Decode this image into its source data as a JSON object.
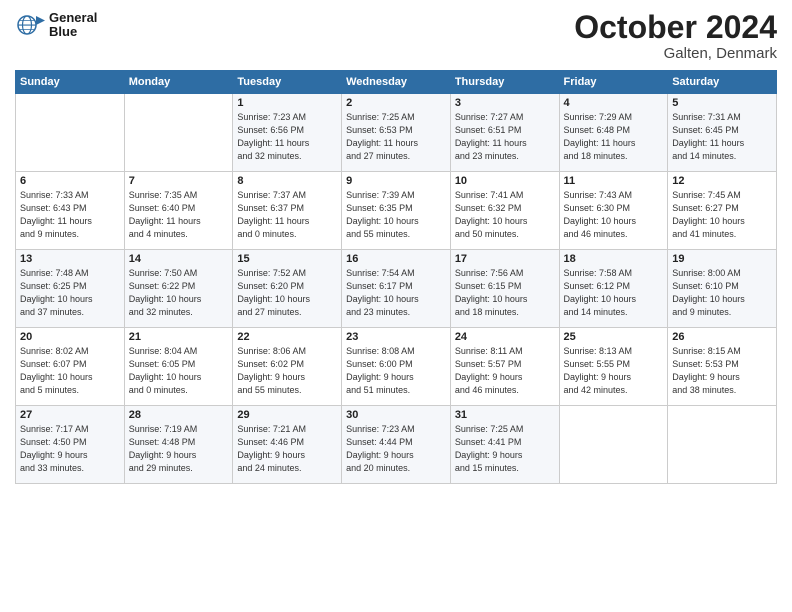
{
  "header": {
    "logo_line1": "General",
    "logo_line2": "Blue",
    "month": "October 2024",
    "location": "Galten, Denmark"
  },
  "days_of_week": [
    "Sunday",
    "Monday",
    "Tuesday",
    "Wednesday",
    "Thursday",
    "Friday",
    "Saturday"
  ],
  "weeks": [
    [
      {
        "day": "",
        "info": ""
      },
      {
        "day": "",
        "info": ""
      },
      {
        "day": "1",
        "info": "Sunrise: 7:23 AM\nSunset: 6:56 PM\nDaylight: 11 hours\nand 32 minutes."
      },
      {
        "day": "2",
        "info": "Sunrise: 7:25 AM\nSunset: 6:53 PM\nDaylight: 11 hours\nand 27 minutes."
      },
      {
        "day": "3",
        "info": "Sunrise: 7:27 AM\nSunset: 6:51 PM\nDaylight: 11 hours\nand 23 minutes."
      },
      {
        "day": "4",
        "info": "Sunrise: 7:29 AM\nSunset: 6:48 PM\nDaylight: 11 hours\nand 18 minutes."
      },
      {
        "day": "5",
        "info": "Sunrise: 7:31 AM\nSunset: 6:45 PM\nDaylight: 11 hours\nand 14 minutes."
      }
    ],
    [
      {
        "day": "6",
        "info": "Sunrise: 7:33 AM\nSunset: 6:43 PM\nDaylight: 11 hours\nand 9 minutes."
      },
      {
        "day": "7",
        "info": "Sunrise: 7:35 AM\nSunset: 6:40 PM\nDaylight: 11 hours\nand 4 minutes."
      },
      {
        "day": "8",
        "info": "Sunrise: 7:37 AM\nSunset: 6:37 PM\nDaylight: 11 hours\nand 0 minutes."
      },
      {
        "day": "9",
        "info": "Sunrise: 7:39 AM\nSunset: 6:35 PM\nDaylight: 10 hours\nand 55 minutes."
      },
      {
        "day": "10",
        "info": "Sunrise: 7:41 AM\nSunset: 6:32 PM\nDaylight: 10 hours\nand 50 minutes."
      },
      {
        "day": "11",
        "info": "Sunrise: 7:43 AM\nSunset: 6:30 PM\nDaylight: 10 hours\nand 46 minutes."
      },
      {
        "day": "12",
        "info": "Sunrise: 7:45 AM\nSunset: 6:27 PM\nDaylight: 10 hours\nand 41 minutes."
      }
    ],
    [
      {
        "day": "13",
        "info": "Sunrise: 7:48 AM\nSunset: 6:25 PM\nDaylight: 10 hours\nand 37 minutes."
      },
      {
        "day": "14",
        "info": "Sunrise: 7:50 AM\nSunset: 6:22 PM\nDaylight: 10 hours\nand 32 minutes."
      },
      {
        "day": "15",
        "info": "Sunrise: 7:52 AM\nSunset: 6:20 PM\nDaylight: 10 hours\nand 27 minutes."
      },
      {
        "day": "16",
        "info": "Sunrise: 7:54 AM\nSunset: 6:17 PM\nDaylight: 10 hours\nand 23 minutes."
      },
      {
        "day": "17",
        "info": "Sunrise: 7:56 AM\nSunset: 6:15 PM\nDaylight: 10 hours\nand 18 minutes."
      },
      {
        "day": "18",
        "info": "Sunrise: 7:58 AM\nSunset: 6:12 PM\nDaylight: 10 hours\nand 14 minutes."
      },
      {
        "day": "19",
        "info": "Sunrise: 8:00 AM\nSunset: 6:10 PM\nDaylight: 10 hours\nand 9 minutes."
      }
    ],
    [
      {
        "day": "20",
        "info": "Sunrise: 8:02 AM\nSunset: 6:07 PM\nDaylight: 10 hours\nand 5 minutes."
      },
      {
        "day": "21",
        "info": "Sunrise: 8:04 AM\nSunset: 6:05 PM\nDaylight: 10 hours\nand 0 minutes."
      },
      {
        "day": "22",
        "info": "Sunrise: 8:06 AM\nSunset: 6:02 PM\nDaylight: 9 hours\nand 55 minutes."
      },
      {
        "day": "23",
        "info": "Sunrise: 8:08 AM\nSunset: 6:00 PM\nDaylight: 9 hours\nand 51 minutes."
      },
      {
        "day": "24",
        "info": "Sunrise: 8:11 AM\nSunset: 5:57 PM\nDaylight: 9 hours\nand 46 minutes."
      },
      {
        "day": "25",
        "info": "Sunrise: 8:13 AM\nSunset: 5:55 PM\nDaylight: 9 hours\nand 42 minutes."
      },
      {
        "day": "26",
        "info": "Sunrise: 8:15 AM\nSunset: 5:53 PM\nDaylight: 9 hours\nand 38 minutes."
      }
    ],
    [
      {
        "day": "27",
        "info": "Sunrise: 7:17 AM\nSunset: 4:50 PM\nDaylight: 9 hours\nand 33 minutes."
      },
      {
        "day": "28",
        "info": "Sunrise: 7:19 AM\nSunset: 4:48 PM\nDaylight: 9 hours\nand 29 minutes."
      },
      {
        "day": "29",
        "info": "Sunrise: 7:21 AM\nSunset: 4:46 PM\nDaylight: 9 hours\nand 24 minutes."
      },
      {
        "day": "30",
        "info": "Sunrise: 7:23 AM\nSunset: 4:44 PM\nDaylight: 9 hours\nand 20 minutes."
      },
      {
        "day": "31",
        "info": "Sunrise: 7:25 AM\nSunset: 4:41 PM\nDaylight: 9 hours\nand 15 minutes."
      },
      {
        "day": "",
        "info": ""
      },
      {
        "day": "",
        "info": ""
      }
    ]
  ]
}
